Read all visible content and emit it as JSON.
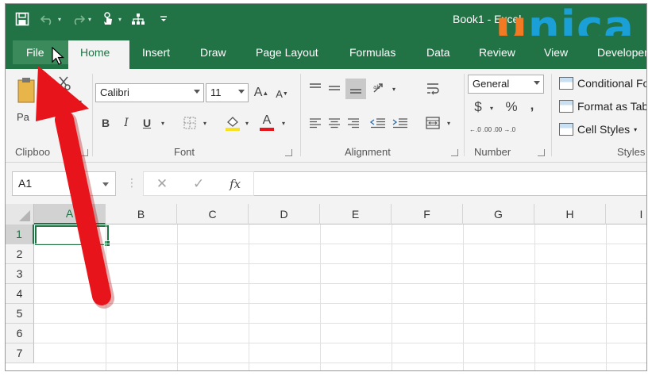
{
  "window": {
    "title": "Book1 - Excel"
  },
  "logo": {
    "letters": [
      "u",
      "n",
      "i",
      "c",
      "a"
    ]
  },
  "tabs": [
    "File",
    "Home",
    "Insert",
    "Draw",
    "Page Layout",
    "Formulas",
    "Data",
    "Review",
    "View",
    "Developer"
  ],
  "ribbon": {
    "clipboard": {
      "label": "Clipboo",
      "paste_label": "Pa"
    },
    "font": {
      "label": "Font",
      "name": "Calibri",
      "size": "11",
      "bold": "B",
      "italic": "I",
      "underline": "U",
      "grow": "A",
      "shrink": "A",
      "font_color": "A"
    },
    "alignment": {
      "label": "Alignment"
    },
    "number": {
      "label": "Number",
      "format": "General",
      "currency": "$",
      "percent": "%",
      "comma": ",",
      "inc_decimal": "←.0 .00",
      "dec_decimal": ".00 →.0"
    },
    "styles": {
      "label": "Styles",
      "conditional": "Conditional Fo",
      "format_table": "Format as Tabl",
      "cell_styles": "Cell Styles"
    }
  },
  "formula_bar": {
    "name_box": "A1",
    "cancel": "✕",
    "enter": "✓",
    "fx": "fx",
    "value": ""
  },
  "grid": {
    "columns": [
      "A",
      "B",
      "C",
      "D",
      "E",
      "F",
      "G",
      "H",
      "I"
    ],
    "rows": [
      "1",
      "2",
      "3",
      "4",
      "5",
      "6",
      "7"
    ],
    "active_cell": "A1"
  },
  "colors": {
    "excel_green": "#217346",
    "arrow_red": "#e8141b",
    "logo_orange": "#f27a22",
    "logo_blue": "#1aa0d6"
  }
}
